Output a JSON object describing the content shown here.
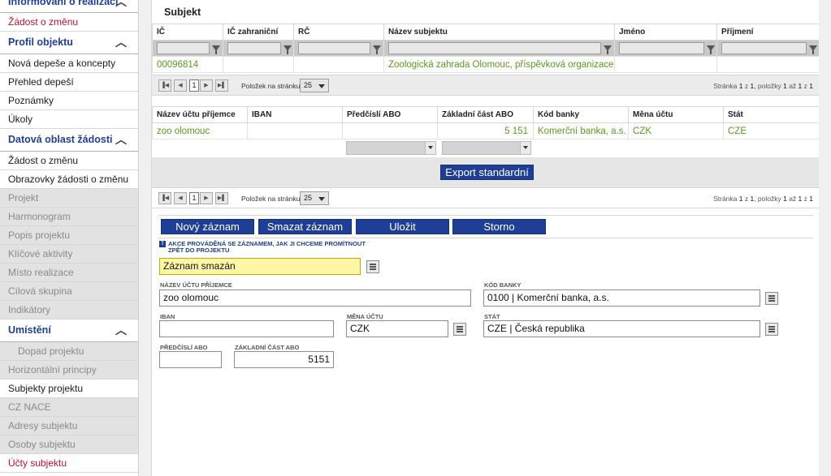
{
  "sidebar": {
    "items": [
      {
        "label": "Informování o realizaci",
        "style": "section top-cut",
        "chevron": "︿"
      },
      {
        "label": "Žádost o změnu",
        "style": "red"
      },
      {
        "label": "Profil objektu",
        "style": "section",
        "chevron": "︿"
      },
      {
        "label": "Nová depeše a koncepty",
        "style": ""
      },
      {
        "label": "Přehled depeší",
        "style": ""
      },
      {
        "label": "Poznámky",
        "style": ""
      },
      {
        "label": "Úkoly",
        "style": ""
      },
      {
        "label": "Datová oblast žádosti",
        "style": "section",
        "chevron": "︿"
      },
      {
        "label": "Žádost o změnu",
        "style": ""
      },
      {
        "label": "Obrazovky žádosti o změnu",
        "style": ""
      },
      {
        "label": "Projekt",
        "style": "grey"
      },
      {
        "label": "Harmonogram",
        "style": "grey"
      },
      {
        "label": "Popis projektu",
        "style": "grey"
      },
      {
        "label": "Klíčové aktivity",
        "style": "grey"
      },
      {
        "label": "Místo realizace",
        "style": "grey"
      },
      {
        "label": "Cílová skupina",
        "style": "grey"
      },
      {
        "label": "Indikátory",
        "style": "grey"
      },
      {
        "label": "Umístění",
        "style": "section",
        "chevron": "︿"
      },
      {
        "label": "Dopad projektu",
        "style": "grey sub"
      },
      {
        "label": "Horizontální principy",
        "style": "grey"
      },
      {
        "label": "Subjekty projektu",
        "style": ""
      },
      {
        "label": "CZ NACE",
        "style": "grey"
      },
      {
        "label": "Adresy subjektu",
        "style": "grey"
      },
      {
        "label": "Osoby subjektu",
        "style": "grey"
      },
      {
        "label": "Účty subjektu",
        "style": "red"
      }
    ]
  },
  "subject_panel": {
    "title": "Subjekt",
    "columns": [
      "IČ",
      "IČ zahraniční",
      "RČ",
      "Název subjektu",
      "Jméno",
      "Příjmení"
    ],
    "rows": [
      [
        "00096814",
        "",
        "",
        "Zoologická zahrada Olomouc, příspěvková organizace",
        "",
        ""
      ]
    ]
  },
  "pager1": {
    "page": "1",
    "per_page_label": "Položek na stránku",
    "per_page": "25",
    "info_prefix": "Stránka ",
    "page_no": "1",
    "of": " z ",
    "pages": "1",
    "items_label": ", položky ",
    "from": "1",
    "to_label": " až ",
    "to": "1",
    "total": "1"
  },
  "accounts_table": {
    "columns": [
      "Název účtu příjemce",
      "IBAN",
      "Předčíslí ABO",
      "Základní část ABO",
      "Kód banky",
      "Měna účtu",
      "Stát"
    ],
    "rows": [
      [
        "zoo olomouc",
        "",
        "",
        "5 151",
        "Komerční banka, a.s.",
        "CZK",
        "CZE"
      ]
    ]
  },
  "export_button": "Export standardní",
  "pager2": {
    "page": "1",
    "per_page_label": "Položek na stránku",
    "per_page": "25",
    "info_prefix": "Stránka ",
    "page_no": "1",
    "of": " z ",
    "pages": "1",
    "items_label": ", položky ",
    "from": "1",
    "to_label": " až ",
    "to": "1",
    "total": "1"
  },
  "actions": {
    "new": "Nový záznam",
    "delete": "Smazat záznam",
    "save": "Uložit",
    "cancel": "Storno"
  },
  "notice": {
    "line1": "Akce prováděná se záznamem, jak ji chceme promítnout",
    "line2": "zpět do projektu"
  },
  "form": {
    "action_value": "Záznam smazán",
    "account_name_label": "Název účtu příjemce",
    "account_name": "zoo olomouc",
    "bank_code_label": "Kód banky",
    "bank_code": "0100 | Komerční banka, a.s.",
    "iban_label": "IBAN",
    "iban": "",
    "currency_label": "Měna účtu",
    "currency": "CZK",
    "country_label": "Stát",
    "country": "CZE | Česká republika",
    "prefix_label": "Předčíslí ABO",
    "prefix": "",
    "base_label": "Základní část ABO",
    "base": "5151"
  },
  "colors": {
    "accent": "#1f3f96",
    "link_green": "#5a9a1a",
    "alert_red": "#c8102e",
    "highlight_yellow": "#fff6a8"
  }
}
